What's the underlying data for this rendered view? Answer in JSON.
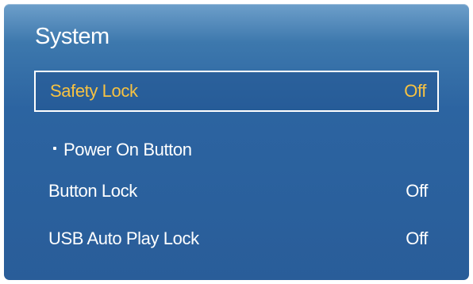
{
  "panel": {
    "title": "System"
  },
  "menu": {
    "items": [
      {
        "label": "Safety Lock",
        "value": "Off"
      },
      {
        "label": "Power On Button"
      },
      {
        "label": "Button Lock",
        "value": "Off"
      },
      {
        "label": "USB Auto Play Lock",
        "value": "Off"
      }
    ]
  },
  "colors": {
    "panel_background": "#2c64a1",
    "selected_text": "#f7c242",
    "normal_text": "#ffffff"
  }
}
